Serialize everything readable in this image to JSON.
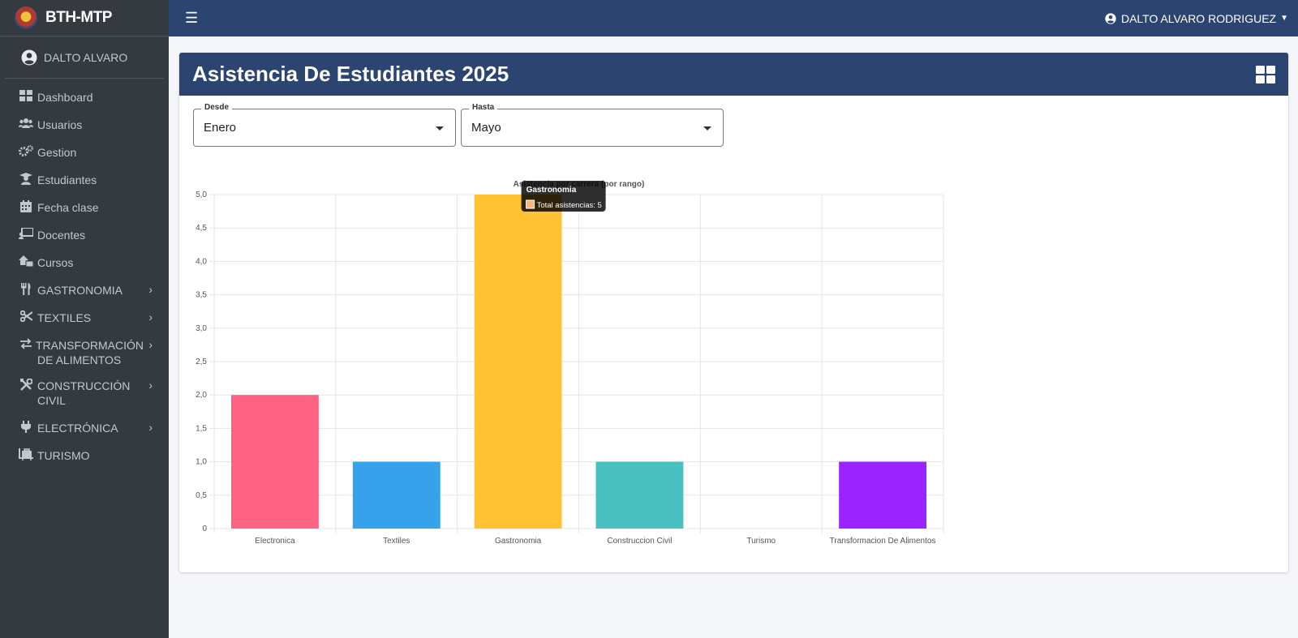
{
  "brand": {
    "name": "BTH-MTP"
  },
  "sidebar": {
    "user": "DALTO ALVARO",
    "items": [
      {
        "label": "Dashboard",
        "icon": "dashboard-icon"
      },
      {
        "label": "Usuarios",
        "icon": "users-icon"
      },
      {
        "label": "Gestion",
        "icon": "gears-icon"
      },
      {
        "label": "Estudiantes",
        "icon": "graduate-icon"
      },
      {
        "label": "Fecha clase",
        "icon": "calendar-icon"
      },
      {
        "label": "Docentes",
        "icon": "teacher-icon"
      },
      {
        "label": "Cursos",
        "icon": "courses-icon"
      },
      {
        "label": "GASTRONOMIA",
        "icon": "utensils-icon"
      },
      {
        "label": "TEXTILES",
        "icon": "scissors-icon"
      },
      {
        "label": "TRANSFORMACIÓN DE ALIMENTOS",
        "icon": "exchange-icon"
      },
      {
        "label": "CONSTRUCCIÓN CIVIL",
        "icon": "tools-icon"
      },
      {
        "label": "ELECTRÓNICA",
        "icon": "plug-icon"
      },
      {
        "label": "TURISMO",
        "icon": "luggage-icon"
      }
    ]
  },
  "topbar": {
    "user_label": "DALTO ALVARO RODRIGUEZ"
  },
  "card": {
    "title": "Asistencia De Estudiantes 2025"
  },
  "filters": {
    "desde": {
      "label": "Desde",
      "value": "Enero"
    },
    "hasta": {
      "label": "Hasta",
      "value": "Mayo"
    }
  },
  "tooltip": {
    "title": "Gastronomia",
    "text": "Total asistencias: 5"
  },
  "chart_data": {
    "type": "bar",
    "title": "Asistencia por carrera (por rango)",
    "categories": [
      "Electronica",
      "Textiles",
      "Gastronomia",
      "Construccion Civil",
      "Turismo",
      "Transformacion De Alimentos"
    ],
    "values": [
      2,
      1,
      5,
      1,
      0,
      1
    ],
    "colors": [
      "#ff6384",
      "#36a2eb",
      "#ffc233",
      "#4bc0c0",
      "#c9cbcf",
      "#9b23ff"
    ],
    "ylim": [
      0,
      5
    ],
    "yticks": [
      "0",
      "0,5",
      "1,0",
      "1,5",
      "2,0",
      "2,5",
      "3,0",
      "3,5",
      "4,0",
      "4,5",
      "5,0"
    ],
    "grid": true,
    "legend": "none"
  }
}
